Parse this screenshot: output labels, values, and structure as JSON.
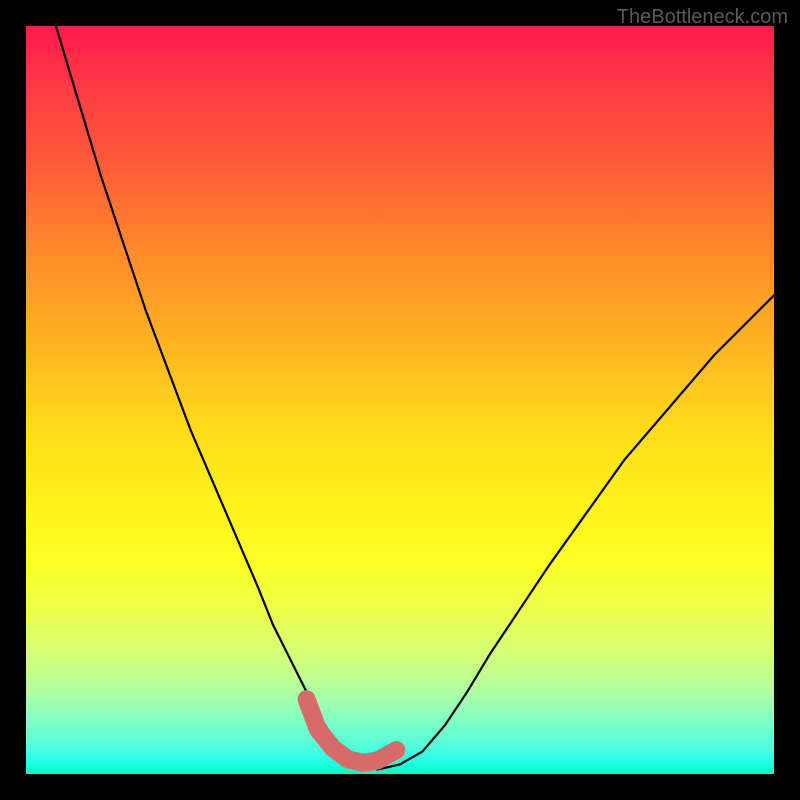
{
  "watermark": "TheBottleneck.com",
  "chart_data": {
    "type": "line",
    "title": "",
    "xlabel": "",
    "ylabel": "",
    "xlim": [
      0,
      100
    ],
    "ylim": [
      0,
      100
    ],
    "series": [
      {
        "name": "curve",
        "x": [
          4,
          7,
          10,
          13,
          16,
          19,
          22,
          25,
          28,
          31,
          33,
          35,
          37,
          39,
          41,
          43,
          45,
          47,
          50,
          53,
          56,
          59,
          62,
          66,
          70,
          75,
          80,
          86,
          92,
          100
        ],
        "y": [
          100,
          90,
          80,
          71,
          62,
          54,
          46,
          39,
          32,
          25,
          20,
          16,
          12,
          8,
          5,
          2.5,
          1.2,
          0.6,
          1.3,
          3,
          6.5,
          11,
          16,
          22,
          28,
          35,
          42,
          49,
          56,
          64
        ]
      }
    ],
    "highlight": {
      "name": "bottom-segment",
      "x": [
        37.5,
        39,
        41,
        43,
        45,
        47,
        49.5
      ],
      "y": [
        10,
        6,
        3.5,
        2,
        1.5,
        1.8,
        3.2
      ]
    },
    "background_gradient": {
      "top": "#ff1a4a",
      "middle": "#fff21a",
      "bottom": "#00ffbd"
    }
  }
}
